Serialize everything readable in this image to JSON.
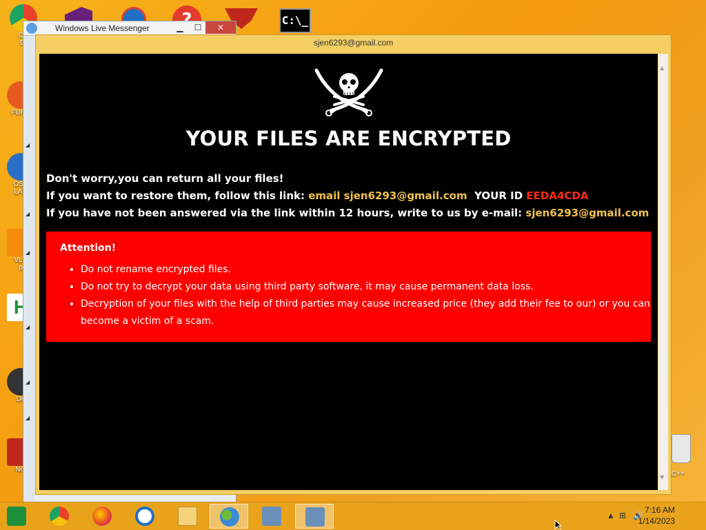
{
  "desktop": {
    "icons": [
      {
        "label": "CH...\nDi...",
        "color": "#e8412c"
      },
      {
        "label": "FURR",
        "color": "#e65a20"
      },
      {
        "label": "OSA\nLAD",
        "color": "#2a6fc7"
      },
      {
        "label": "VLC\np",
        "color": "#f58a0b"
      },
      {
        "label": "",
        "color": "#1e8f3a"
      },
      {
        "label": "Do",
        "color": "#333333"
      },
      {
        "label": "Not",
        "color": "#c0271c"
      }
    ],
    "right_label": "on C++"
  },
  "messenger_window": {
    "title": "Windows Live Messenger",
    "minimize": "▁",
    "maximize": "☐",
    "close": "✕"
  },
  "ransom_window": {
    "title": "sjen6293@gmail.com",
    "headline": "YOUR FILES ARE ENCRYPTED",
    "line1": "Don't worry,you can return all your files!",
    "line2_prefix": "If you want to restore them, follow this link:",
    "line2_email": "email sjen6293@gmail.com",
    "line2_id_label": "YOUR ID",
    "line2_id": "EEDA4CDA",
    "line3_prefix": "If you have not been answered via the link within 12 hours, write to us by e-mail:",
    "line3_email": "sjen6293@gmail.com",
    "attention": {
      "heading": "Attention!",
      "items": [
        "Do not rename encrypted files.",
        "Do not try to decrypt your data using third party software, it may cause permanent data loss.",
        "Decryption of your files with the help of third parties may cause increased price (they add their fee to our) or you can become a victim of a scam."
      ]
    }
  },
  "taskbar": {
    "time": "7:16 AM",
    "date": "1/14/2023"
  }
}
